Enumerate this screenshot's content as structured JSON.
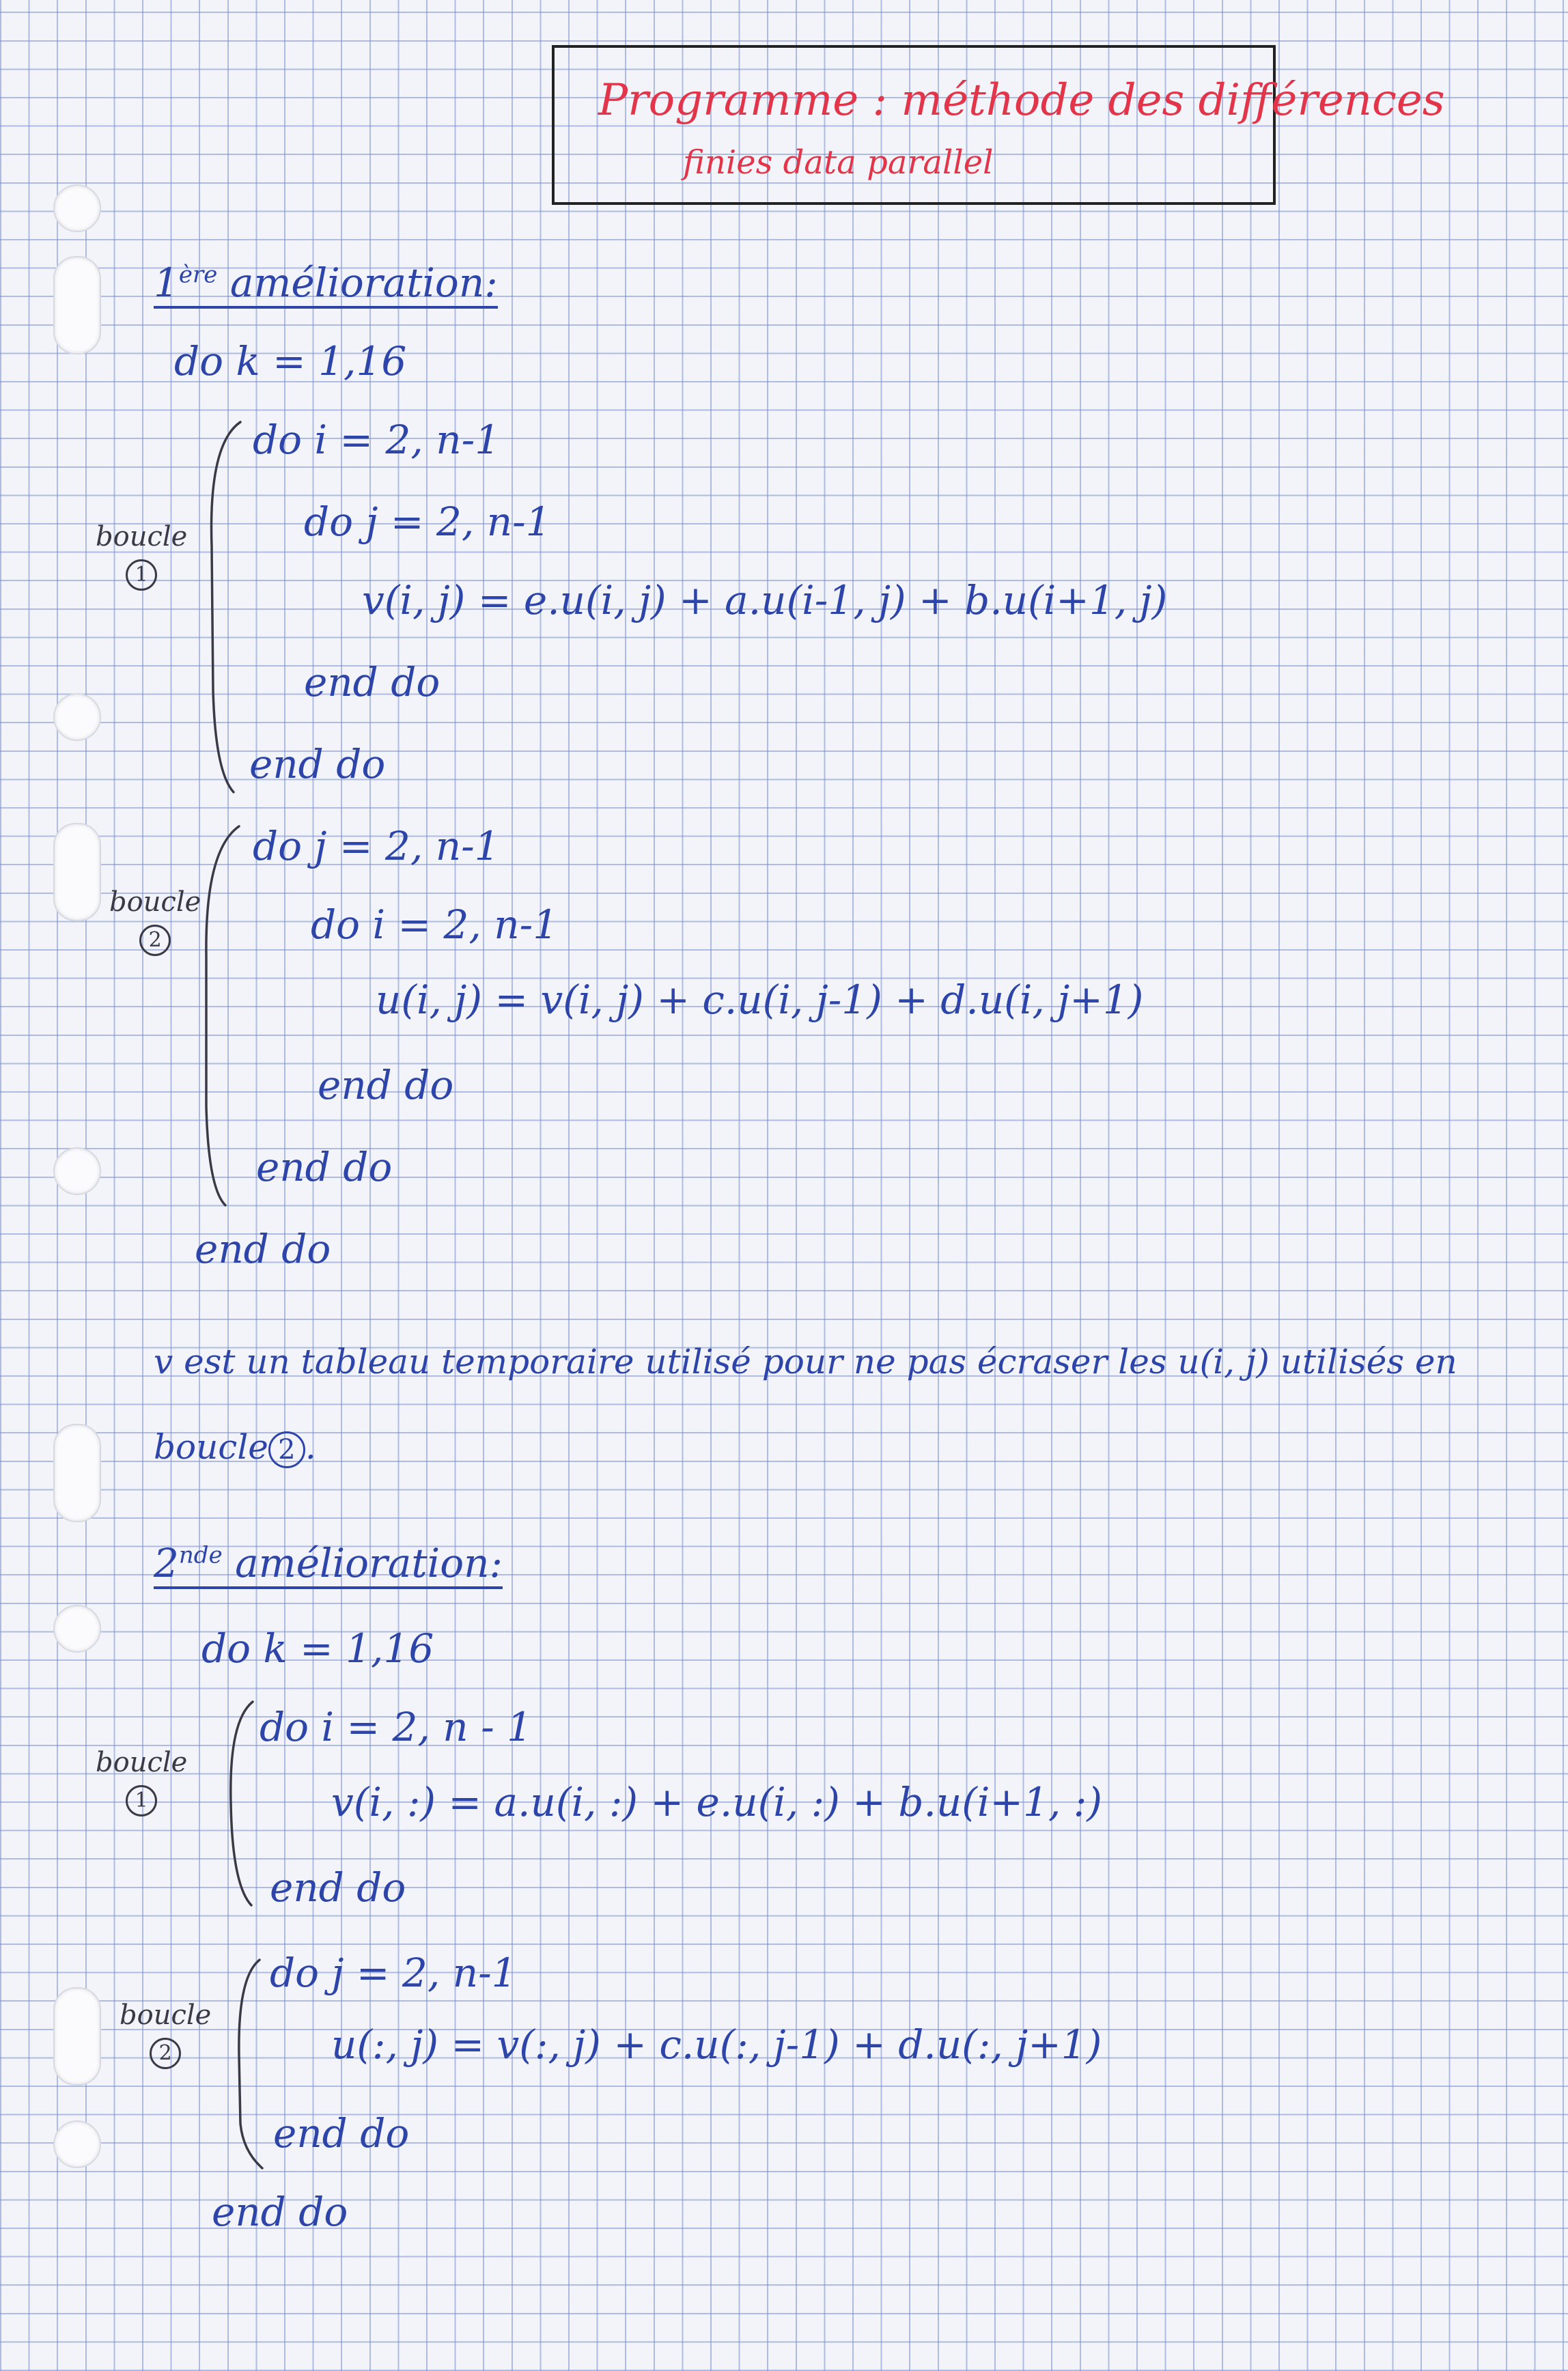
{
  "title": {
    "line1": "Programme : méthode des différences",
    "line2": "finies data parallel"
  },
  "section1": {
    "heading_base": "1",
    "heading_sup": "ère",
    "heading_text": "amélioration:",
    "outer_do": "do  k = 1,16",
    "loop1": {
      "label": "boucle",
      "number": "1",
      "line1": "do  i = 2, n-1",
      "line2": "do  j = 2, n-1",
      "line3": "v(i, j) = e.u(i, j) + a.u(i-1, j) + b.u(i+1, j)",
      "line4": "end do",
      "line5": "end do"
    },
    "loop2": {
      "label": "boucle",
      "number": "2",
      "line1": "do  j = 2, n-1",
      "line2": "do  i = 2, n-1",
      "line3": "u(i, j) = v(i, j) + c.u(i, j-1) + d.u(i, j+1)",
      "line4": "end do",
      "line5": "end do"
    },
    "outer_end": "end do"
  },
  "paragraph": {
    "line1": "v est un tableau temporaire utilisé pour ne pas écraser les u(i, j) utilisés en",
    "line2_text": "boucle",
    "line2_number": "2",
    "line2_end": "."
  },
  "section2": {
    "heading_base": "2",
    "heading_sup": "nde",
    "heading_text": "amélioration:",
    "outer_do": "do  k = 1,16",
    "loop1": {
      "label": "boucle",
      "number": "1",
      "line1": "do  i = 2, n - 1",
      "line2": "v(i, :) = a.u(i, :) + e.u(i, :) + b.u(i+1, :)",
      "line3": "end do"
    },
    "loop2": {
      "label": "boucle",
      "number": "2",
      "line1": "do  j = 2, n-1",
      "line2": "u(:, j) = v(:, j) + c.u(:, j-1) + d.u(:, j+1)",
      "line3": "end do"
    },
    "outer_end": "end do"
  }
}
